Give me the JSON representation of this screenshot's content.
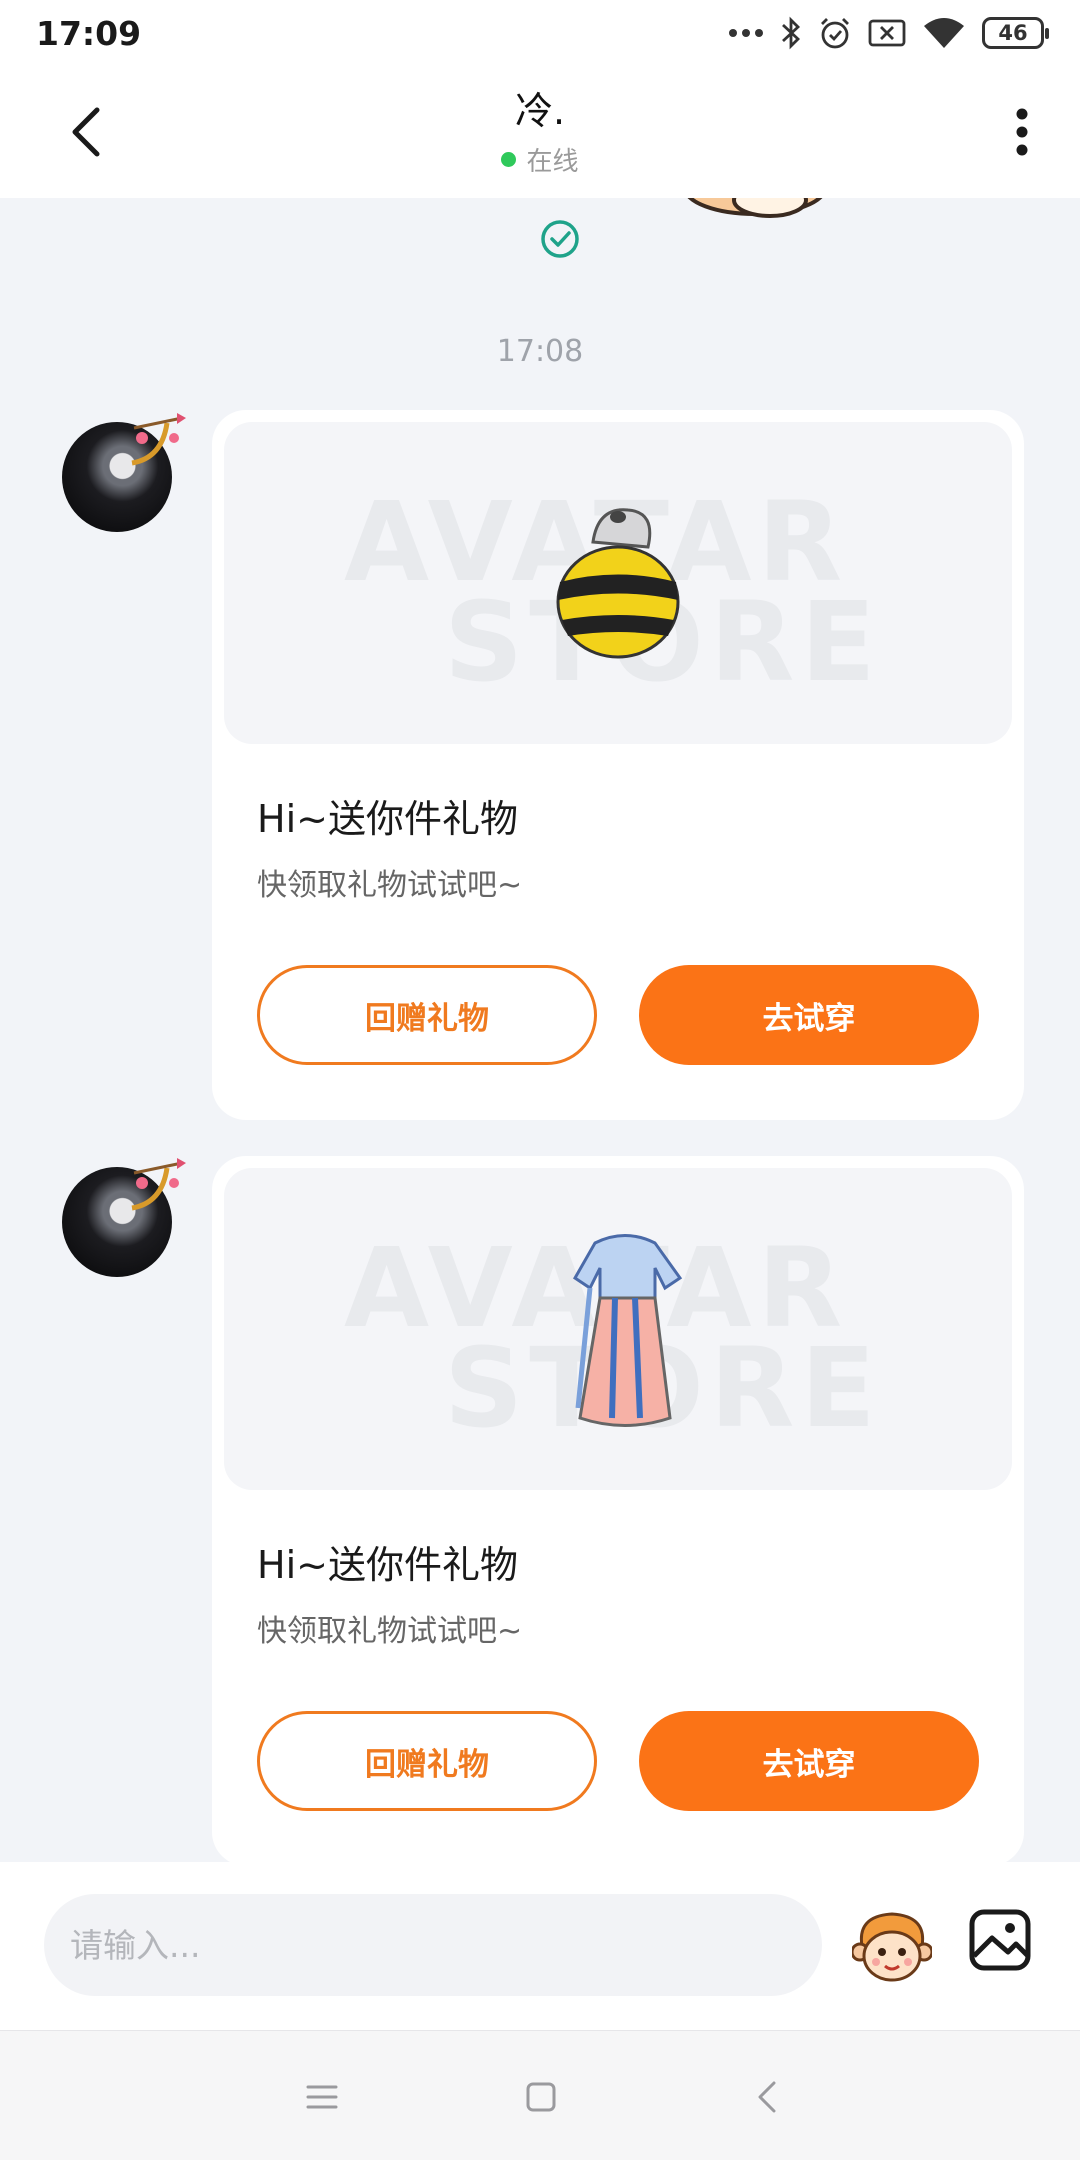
{
  "status_bar": {
    "time": "17:09",
    "battery": "46",
    "icons": [
      "dots-icon",
      "bluetooth-icon",
      "alarm-icon",
      "sim-off-icon",
      "wifi-icon",
      "battery-icon"
    ]
  },
  "header": {
    "contact_name": "冷.",
    "status": "在线",
    "status_color": "#2fc95b"
  },
  "chat": {
    "timestamp": "17:08",
    "messages": [
      {
        "type": "gift",
        "item": "bee-costume",
        "watermark_line1": "AVATAR",
        "watermark_line2": "STORE",
        "title": "Hi~送你件礼物",
        "subtitle": "快领取礼物试试吧~",
        "return_label": "回赠礼物",
        "try_label": "去试穿"
      },
      {
        "type": "gift",
        "item": "hanfu-dress",
        "watermark_line1": "AVATAR",
        "watermark_line2": "STORE",
        "title": "Hi~送你件礼物",
        "subtitle": "快领取礼物试试吧~",
        "return_label": "回赠礼物",
        "try_label": "去试穿"
      }
    ]
  },
  "input": {
    "placeholder": "请输入..."
  },
  "colors": {
    "accent": "#fb7316",
    "accent_border": "#f07a1f",
    "background": "#f2f4f8"
  }
}
